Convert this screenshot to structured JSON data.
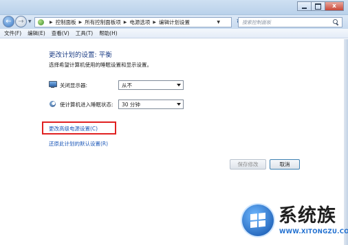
{
  "window": {
    "min_label": "",
    "max_label": "",
    "close_label": "x"
  },
  "nav": {
    "back_icon": "back-arrow-icon",
    "forward_icon": "forward-arrow-icon",
    "refresh_glyph": "↻",
    "breadcrumbs": [
      "控制面板",
      "所有控制面板项",
      "电源选项",
      "编辑计划设置"
    ],
    "search_placeholder": "搜索控制面板"
  },
  "menu": {
    "items": [
      "文件(F)",
      "编辑(E)",
      "查看(V)",
      "工具(T)",
      "帮助(H)"
    ]
  },
  "main": {
    "title": "更改计划的设置: 平衡",
    "subtitle": "选择希望计算机使用的睡眠设置和显示设置。",
    "settings": [
      {
        "label": "关闭显示器:",
        "value": "从不",
        "icon": "monitor-icon"
      },
      {
        "label": "使计算机进入睡眠状态:",
        "value": "30 分钟",
        "icon": "moon-icon"
      }
    ],
    "links": {
      "advanced": "更改高级电源设置(C)",
      "restore": "还原此计划的默认设置(R)"
    },
    "buttons": {
      "save": "保存修改",
      "cancel": "取消"
    }
  },
  "colors": {
    "highlight": "#e02020",
    "link": "#1b57b8",
    "title": "#1e3f86"
  },
  "watermark": {
    "brand": "系统族",
    "url": "WWW.XITONGZU.COM"
  }
}
